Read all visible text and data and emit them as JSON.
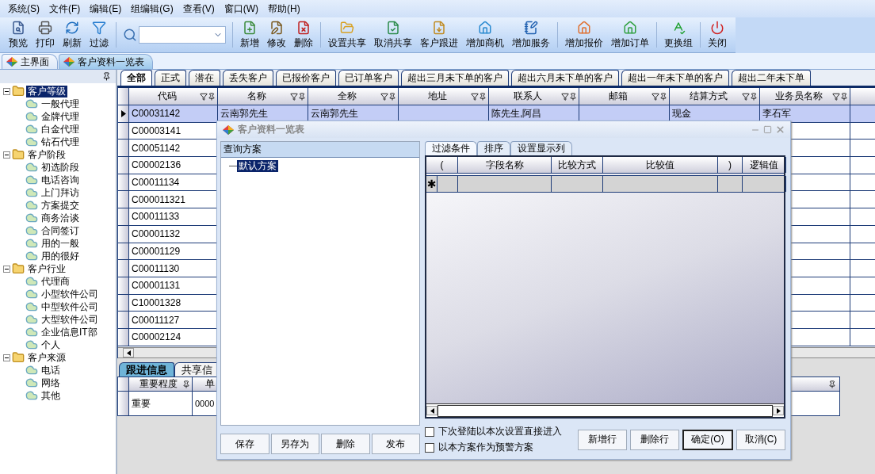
{
  "menu": [
    "系统(S)",
    "文件(F)",
    "编辑(E)",
    "组编辑(G)",
    "查看(V)",
    "窗口(W)",
    "帮助(H)"
  ],
  "toolbar": [
    {
      "kind": "button",
      "label": "预览"
    },
    {
      "kind": "button",
      "label": "打印"
    },
    {
      "kind": "button",
      "label": "刷新"
    },
    {
      "kind": "button",
      "label": "过滤"
    },
    {
      "kind": "separator"
    },
    {
      "kind": "combo"
    },
    {
      "kind": "separator"
    },
    {
      "kind": "button",
      "label": "新增"
    },
    {
      "kind": "button",
      "label": "修改"
    },
    {
      "kind": "button",
      "label": "删除"
    },
    {
      "kind": "separator"
    },
    {
      "kind": "button",
      "label": "设置共享"
    },
    {
      "kind": "button",
      "label": "取消共享"
    },
    {
      "kind": "button",
      "label": "客户跟进"
    },
    {
      "kind": "button",
      "label": "增加商机"
    },
    {
      "kind": "button",
      "label": "增加服务"
    },
    {
      "kind": "separator"
    },
    {
      "kind": "button",
      "label": "增加报价"
    },
    {
      "kind": "button",
      "label": "增加订单"
    },
    {
      "kind": "separator"
    },
    {
      "kind": "button",
      "label": "更换组"
    },
    {
      "kind": "separator"
    },
    {
      "kind": "button",
      "label": "关闭"
    }
  ],
  "doc_tabs": [
    {
      "label": "主界面",
      "selected": false
    },
    {
      "label": "客户资料一览表",
      "selected": true
    }
  ],
  "tree": [
    {
      "label": "客户等级",
      "selected": true,
      "expanded": true,
      "children": [
        {
          "label": "一般代理",
          "selected": false
        },
        {
          "label": "金牌代理",
          "selected": false
        },
        {
          "label": "白金代理",
          "selected": false
        },
        {
          "label": "钻石代理",
          "selected": false
        }
      ]
    },
    {
      "label": "客户阶段",
      "selected": false,
      "expanded": true,
      "children": [
        {
          "label": "初选阶段",
          "selected": false
        },
        {
          "label": "电话咨询",
          "selected": false
        },
        {
          "label": "上门拜访",
          "selected": false
        },
        {
          "label": "方案提交",
          "selected": false
        },
        {
          "label": "商务洽谈",
          "selected": false
        },
        {
          "label": "合同签订",
          "selected": false
        },
        {
          "label": "用的一般",
          "selected": false
        },
        {
          "label": "用的很好",
          "selected": false
        }
      ]
    },
    {
      "label": "客户行业",
      "selected": false,
      "expanded": true,
      "children": [
        {
          "label": "代理商",
          "selected": false
        },
        {
          "label": "小型软件公司",
          "selected": false
        },
        {
          "label": "中型软件公司",
          "selected": false
        },
        {
          "label": "大型软件公司",
          "selected": false
        },
        {
          "label": "企业信息IT部",
          "selected": false
        },
        {
          "label": "个人",
          "selected": false
        }
      ]
    },
    {
      "label": "客户来源",
      "selected": false,
      "expanded": true,
      "children": [
        {
          "label": "电话",
          "selected": false
        },
        {
          "label": "网络",
          "selected": false
        },
        {
          "label": "其他",
          "selected": false
        }
      ]
    }
  ],
  "filter_tabs": [
    {
      "label": "全部",
      "selected": true
    },
    {
      "label": "正式",
      "selected": false
    },
    {
      "label": "潜在",
      "selected": false
    },
    {
      "label": "丢失客户",
      "selected": false
    },
    {
      "label": "已报价客户",
      "selected": false
    },
    {
      "label": "已订单客户",
      "selected": false
    },
    {
      "label": "超出三月未下单的客户",
      "selected": false
    },
    {
      "label": "超出六月未下单的客户",
      "selected": false
    },
    {
      "label": "超出一年未下单的客户",
      "selected": false
    },
    {
      "label": "超出二年未下单",
      "selected": false
    }
  ],
  "grid": {
    "columns": [
      "代码",
      "名称",
      "全称",
      "地址",
      "联系人",
      "邮箱",
      "结算方式",
      "业务员名称"
    ],
    "rows": [
      {
        "code": "C00031142",
        "name": "云南郭先生",
        "full_name": "云南郭先生",
        "contact": "陈先生,阿昌",
        "settlement": "现金",
        "salesperson": "李石军",
        "selected": true
      },
      {
        "code": "C00003141",
        "selected": false
      },
      {
        "code": "C00051142",
        "selected": false
      },
      {
        "code": "C00002136",
        "selected": false
      },
      {
        "code": "C00011134",
        "selected": false
      },
      {
        "code": "C000011321",
        "selected": false
      },
      {
        "code": "C00011133",
        "selected": false
      },
      {
        "code": "C00001132",
        "selected": false
      },
      {
        "code": "C00001129",
        "selected": false
      },
      {
        "code": "C00011130",
        "selected": false
      },
      {
        "code": "C00001131",
        "selected": false
      },
      {
        "code": "C10001328",
        "selected": false
      },
      {
        "code": "C00011127",
        "selected": false
      },
      {
        "code": "C00002124",
        "selected": false
      }
    ]
  },
  "bottom_tabs": [
    {
      "label": "跟进信息",
      "selected": true
    },
    {
      "label": "共享信",
      "selected": false
    }
  ],
  "detail_grid": {
    "columns": [
      "重要程度",
      "单"
    ],
    "rows": [
      [
        "重要",
        "0000"
      ]
    ]
  },
  "dialog": {
    "title": "客户资料一览表",
    "scheme_header": "查询方案",
    "schemes": [
      {
        "label": "默认方案",
        "selected": true
      }
    ],
    "scheme_buttons": [
      "保存",
      "另存为",
      "删除",
      "发布"
    ],
    "tabs": [
      {
        "label": "过滤条件",
        "selected": true
      },
      {
        "label": "排序",
        "selected": false
      },
      {
        "label": "设置显示列",
        "selected": false
      }
    ],
    "filter_columns": [
      "(",
      "字段名称",
      "比较方式",
      "比较值",
      ")",
      "逻辑值"
    ],
    "new_row_mark": "✱",
    "options": [
      {
        "label": "下次登陆以本次设置直接进入",
        "checked": false
      },
      {
        "label": "以本方案作为预警方案",
        "checked": false
      }
    ],
    "buttons": [
      {
        "label": "新增行",
        "default": false
      },
      {
        "label": "删除行",
        "default": false
      },
      {
        "label": "确定(O)",
        "default": true
      },
      {
        "label": "取消(C)",
        "default": false
      }
    ]
  }
}
